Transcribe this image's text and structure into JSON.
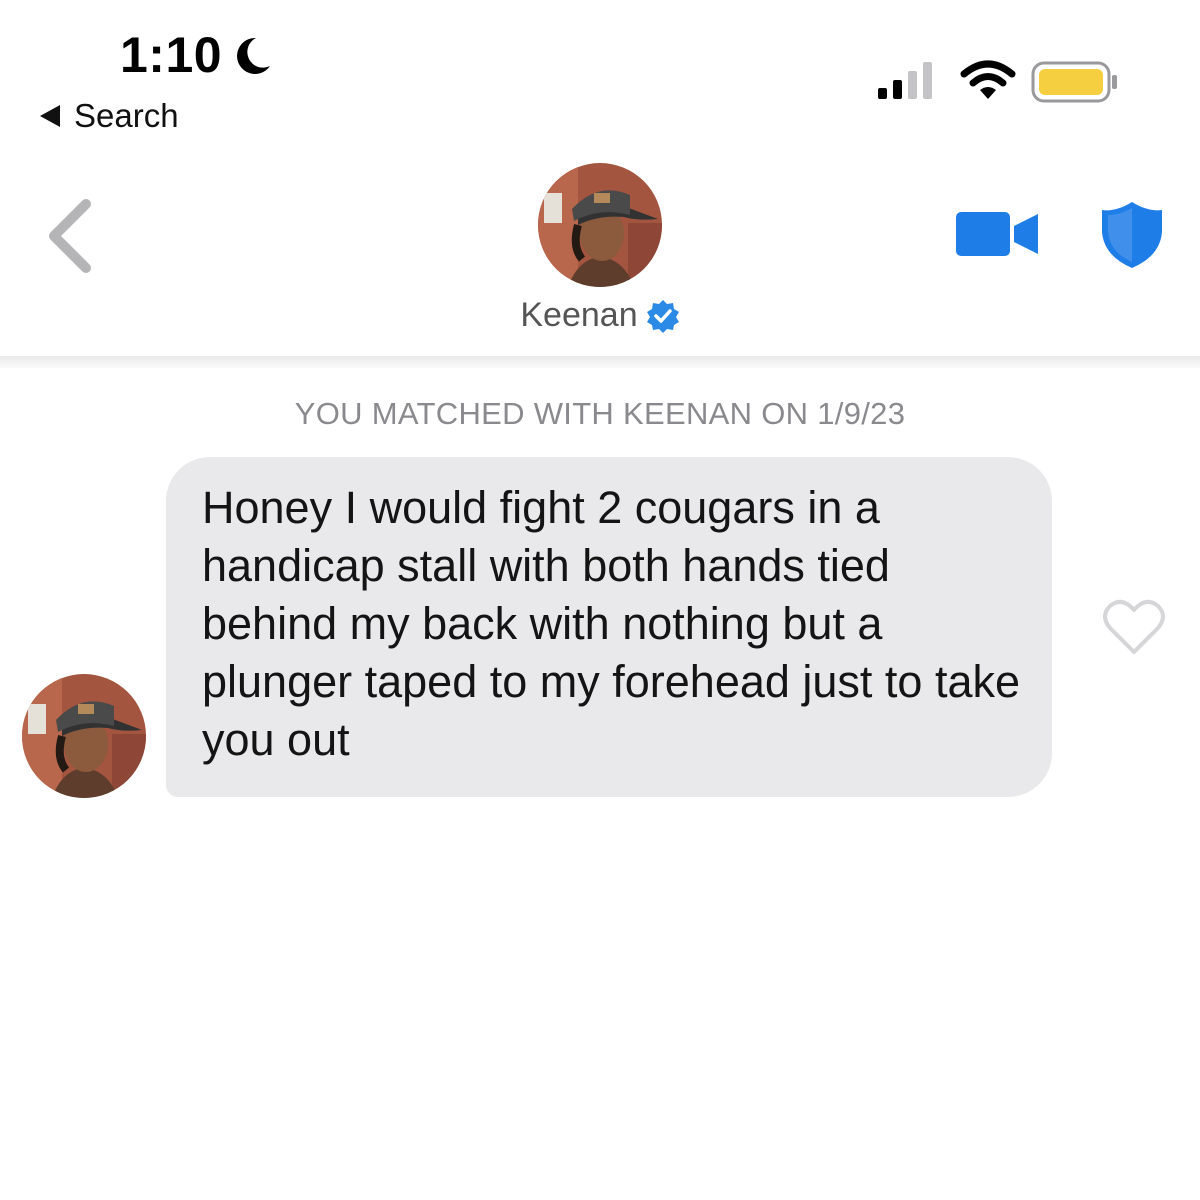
{
  "status_bar": {
    "time": "1:10",
    "back_label": "Search",
    "icons": [
      "moon-icon",
      "signal-icon",
      "wifi-icon",
      "battery-icon"
    ],
    "battery_color": "#f5cf3f"
  },
  "header": {
    "name": "Keenan",
    "verified": true,
    "icons": [
      "chevron-left-icon",
      "video-call-icon",
      "shield-icon",
      "verified-icon"
    ],
    "accent_color": "#1f7de8"
  },
  "conversation": {
    "match_banner": "YOU MATCHED WITH KEENAN ON 1/9/23",
    "messages": [
      {
        "sender": "Keenan",
        "text": "Honey I would fight 2 cougars in a handicap stall with both hands tied behind my back with nothing but a plunger taped to my forehead just to take you out",
        "liked": false
      }
    ],
    "bubble_color": "#e9e9eb"
  }
}
